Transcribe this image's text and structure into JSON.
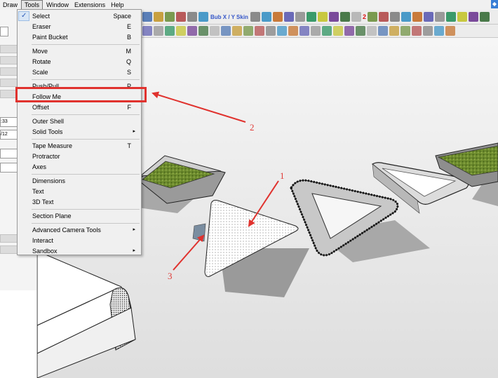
{
  "menubar": {
    "items": [
      "Draw",
      "Tools",
      "Window",
      "Extensions",
      "Help"
    ],
    "active": "Tools"
  },
  "toolbar": {
    "plugin_label": "Bub X / Y Skin",
    "red_number": "2"
  },
  "left_panel": {
    "field_1": ":33",
    "field_2": "/12"
  },
  "tools_menu": {
    "checkmark": "✓",
    "submenu_arrow": "▸",
    "groups": [
      [
        {
          "label": "Select",
          "shortcut": "Space",
          "checked": true
        },
        {
          "label": "Eraser",
          "shortcut": "E"
        },
        {
          "label": "Paint Bucket",
          "shortcut": "B"
        }
      ],
      [
        {
          "label": "Move",
          "shortcut": "M"
        },
        {
          "label": "Rotate",
          "shortcut": "Q"
        },
        {
          "label": "Scale",
          "shortcut": "S"
        }
      ],
      [
        {
          "label": "Push/Pull",
          "shortcut": "P"
        },
        {
          "label": "Follow Me",
          "shortcut": "",
          "highlighted": true
        },
        {
          "label": "Offset",
          "shortcut": "F"
        }
      ],
      [
        {
          "label": "Outer Shell",
          "shortcut": ""
        },
        {
          "label": "Solid Tools",
          "shortcut": "",
          "submenu": true
        }
      ],
      [
        {
          "label": "Tape Measure",
          "shortcut": "T"
        },
        {
          "label": "Protractor",
          "shortcut": ""
        },
        {
          "label": "Axes",
          "shortcut": ""
        }
      ],
      [
        {
          "label": "Dimensions",
          "shortcut": ""
        },
        {
          "label": "Text",
          "shortcut": ""
        },
        {
          "label": "3D Text",
          "shortcut": ""
        }
      ],
      [
        {
          "label": "Section Plane",
          "shortcut": ""
        }
      ],
      [
        {
          "label": "Advanced Camera Tools",
          "shortcut": "",
          "submenu": true
        },
        {
          "label": "Interact",
          "shortcut": ""
        },
        {
          "label": "Sandbox",
          "shortcut": "",
          "submenu": true
        }
      ]
    ]
  },
  "annotations": {
    "one": "1",
    "two": "2",
    "three": "3"
  },
  "colors": {
    "accent_red": "#e0322e",
    "menu_bg": "#f0f0f0",
    "viewport_bg": "#e8e8e8",
    "grass_green": "#6d8b2e"
  }
}
